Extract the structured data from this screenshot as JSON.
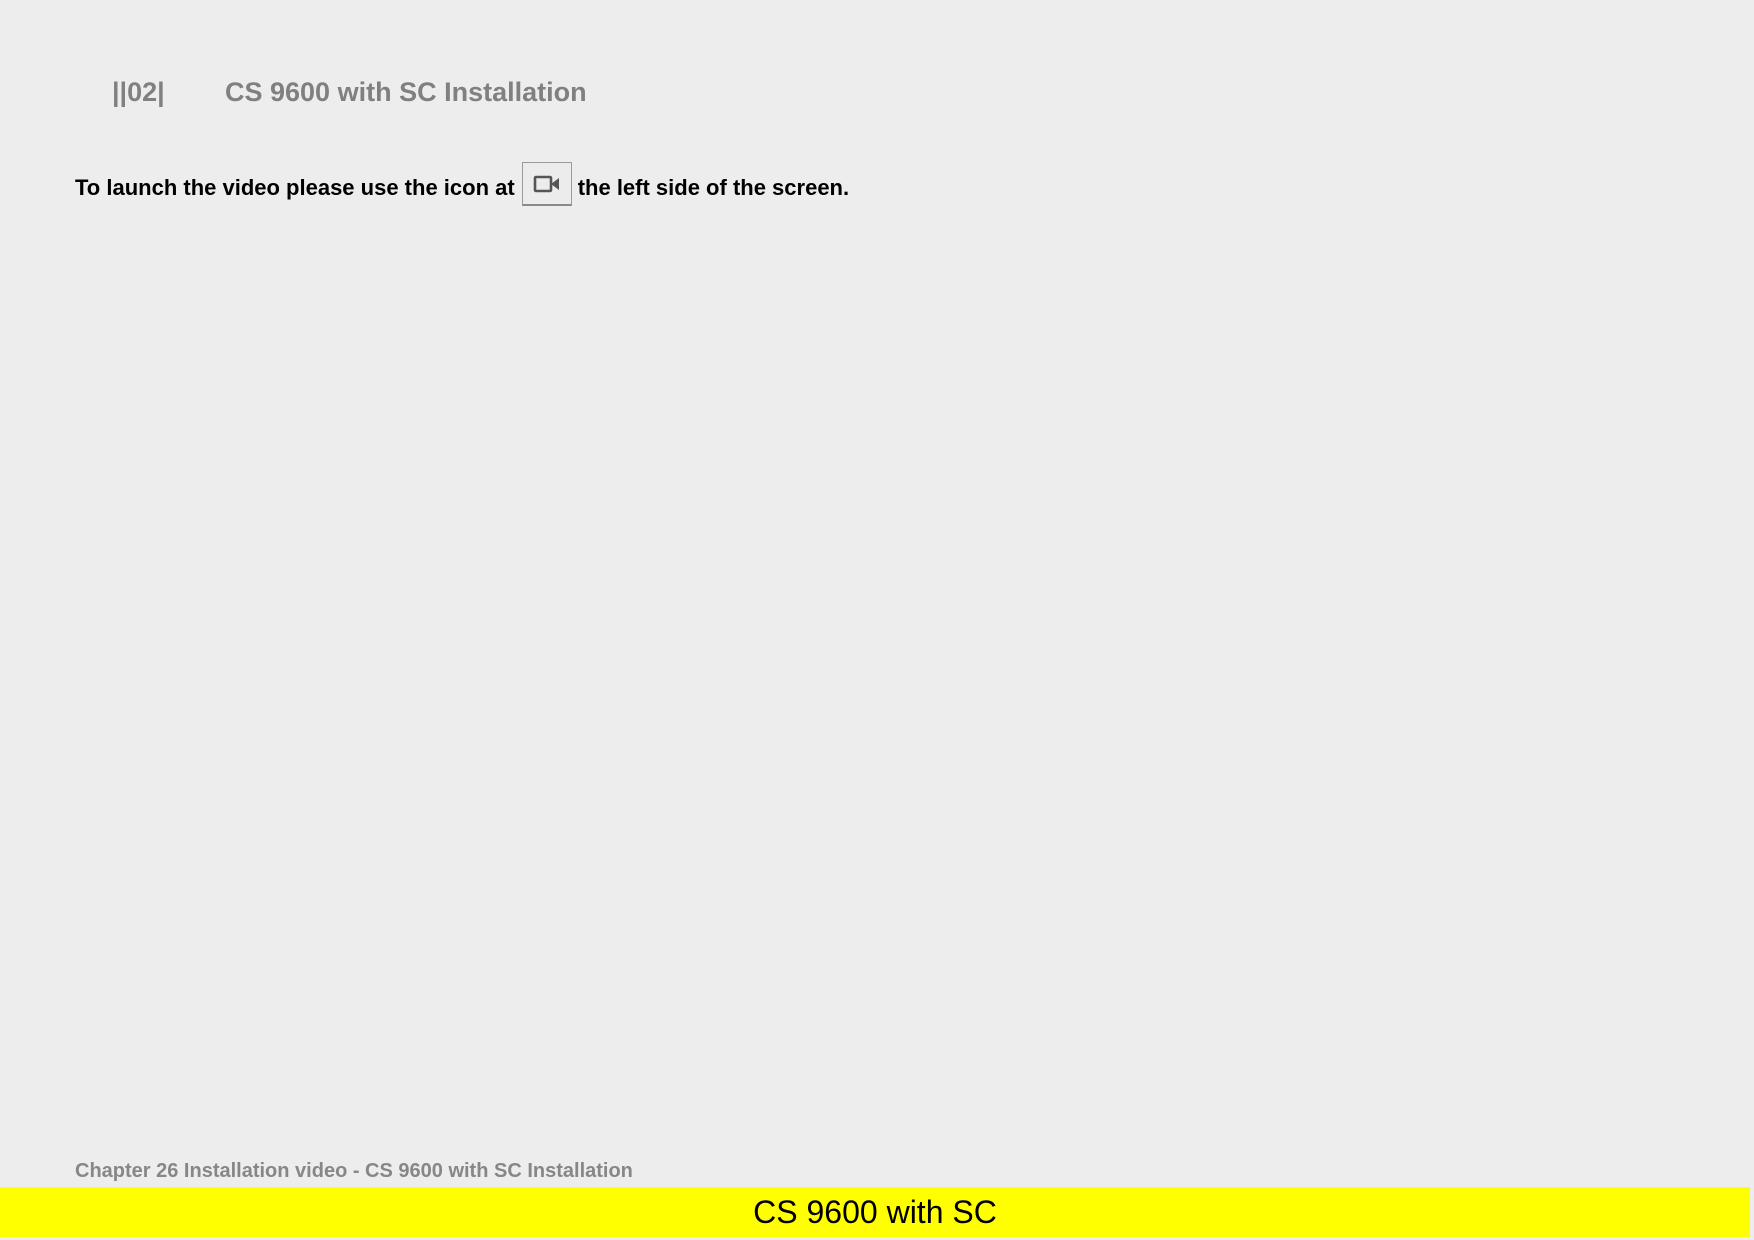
{
  "header": {
    "number": "||02|",
    "title": "CS 9600 with SC Installation"
  },
  "instruction": {
    "before_icon": "To launch the video please use the icon at",
    "icon": "video-camera-icon",
    "after_icon": "the left side of the screen."
  },
  "footer": {
    "chapter_line": "Chapter 26 Installation video - CS 9600 with SC Installation",
    "banner_text": "CS 9600 with SC"
  },
  "colors": {
    "background": "#ededed",
    "header_text": "#808080",
    "banner": "#ffff00"
  }
}
